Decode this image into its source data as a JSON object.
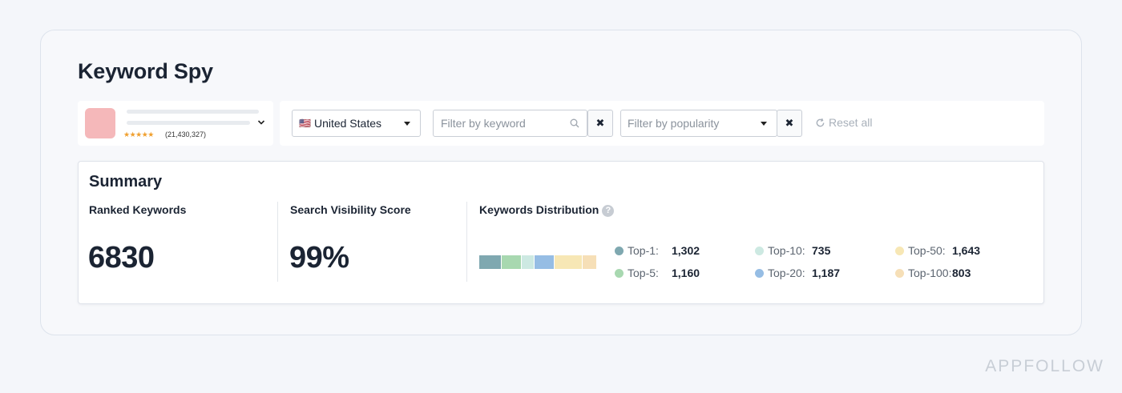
{
  "page": {
    "title": "Keyword Spy"
  },
  "app_picker": {
    "stars": "★★★★★",
    "rating_count": "(21,430,327)"
  },
  "filters": {
    "country": {
      "flag": "🇺🇸",
      "value": "United States"
    },
    "keyword": {
      "placeholder": "Filter by keyword"
    },
    "popularity": {
      "placeholder": "Filter by popularity"
    },
    "clear_label": "✖",
    "reset_label": "Reset all"
  },
  "summary": {
    "title": "Summary",
    "ranked_keywords": {
      "label": "Ranked Keywords",
      "value": "6830"
    },
    "visibility": {
      "label": "Search Visibility Score",
      "value": "99%"
    },
    "distribution": {
      "label": "Keywords Distribution",
      "help": "?",
      "items": [
        {
          "name": "Top-1:",
          "value": "1,302",
          "color": "#7fa8b0"
        },
        {
          "name": "Top-5:",
          "value": "1,160",
          "color": "#a8d8b0"
        },
        {
          "name": "Top-10:",
          "value": "735",
          "color": "#cde9e2"
        },
        {
          "name": "Top-20:",
          "value": "1,187",
          "color": "#96bde4"
        },
        {
          "name": "Top-50:",
          "value": "1,643",
          "color": "#f7e7b5"
        },
        {
          "name": "Top-100:",
          "value": "803",
          "color": "#f6dfb7"
        }
      ]
    }
  },
  "watermark": "APPFOLLOW"
}
